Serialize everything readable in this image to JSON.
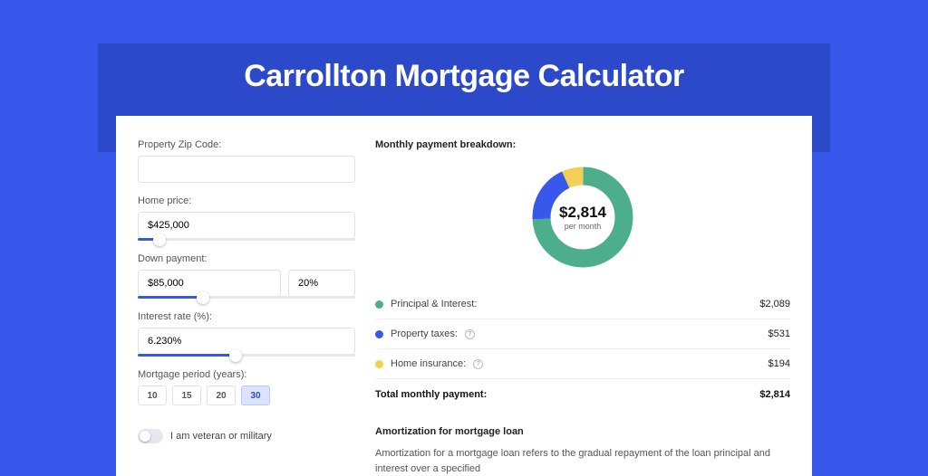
{
  "page_title": "Carrollton Mortgage Calculator",
  "colors": {
    "principal": "#4dae8c",
    "taxes": "#3858ec",
    "insurance": "#f3cf58"
  },
  "form": {
    "zip": {
      "label": "Property Zip Code:",
      "value": ""
    },
    "price": {
      "label": "Home price:",
      "value": "$425,000",
      "slider_pct": 10
    },
    "down": {
      "label": "Down payment:",
      "value": "$85,000",
      "pct": "20%",
      "slider_pct": 30
    },
    "rate": {
      "label": "Interest rate (%):",
      "value": "6.230%",
      "slider_pct": 45
    },
    "period": {
      "label": "Mortgage period (years):",
      "options": [
        "10",
        "15",
        "20",
        "30"
      ],
      "selected": "30"
    },
    "veteran": {
      "label": "I am veteran or military"
    }
  },
  "breakdown": {
    "title": "Monthly payment breakdown:",
    "center_value": "$2,814",
    "center_sub": "per month",
    "rows": [
      {
        "label": "Principal & Interest:",
        "value": "$2,089",
        "color_key": "principal",
        "info": false
      },
      {
        "label": "Property taxes:",
        "value": "$531",
        "color_key": "taxes",
        "info": true
      },
      {
        "label": "Home insurance:",
        "value": "$194",
        "color_key": "insurance",
        "info": true
      }
    ],
    "total_label": "Total monthly payment:",
    "total_value": "$2,814"
  },
  "amortization": {
    "title": "Amortization for mortgage loan",
    "text": "Amortization for a mortgage loan refers to the gradual repayment of the loan principal and interest over a specified"
  },
  "chart_data": {
    "type": "pie",
    "title": "Monthly payment breakdown",
    "total": 2814,
    "unit": "USD/month",
    "series": [
      {
        "name": "Principal & Interest",
        "value": 2089,
        "color": "#4dae8c"
      },
      {
        "name": "Property taxes",
        "value": 531,
        "color": "#3858ec"
      },
      {
        "name": "Home insurance",
        "value": 194,
        "color": "#f3cf58"
      }
    ]
  }
}
